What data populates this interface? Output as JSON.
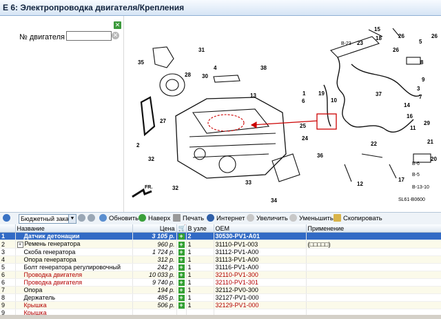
{
  "window": {
    "title": "E 6: Электропроводка двигателя/Крепления"
  },
  "left_panel": {
    "close_icon": "green-close-icon",
    "engine_label": "№ двигателя",
    "engine_value": "",
    "clear_icon": "clear-icon"
  },
  "diagram": {
    "callouts": [
      "35",
      "31",
      "28",
      "30",
      "4",
      "38",
      "13",
      "27",
      "2",
      "32",
      "32",
      "33",
      "34",
      "1",
      "18",
      "10",
      "36",
      "25",
      "24",
      "26",
      "15",
      "23",
      "17",
      "12",
      "19",
      "14",
      "37",
      "6",
      "16",
      "7",
      "22",
      "11",
      "8",
      "9",
      "3",
      "29",
      "21",
      "20",
      "5",
      "26",
      "26"
    ],
    "side_labels": [
      "B-23",
      "B-6",
      "B-5",
      "B-13-10"
    ],
    "front_marker": "FR.",
    "figure_code": "SL61-B0600",
    "title": ""
  },
  "toolbar": {
    "price_select": "Бюджетный зака",
    "refresh": "Обновить",
    "up": "Наверх",
    "print": "Печать",
    "internet": "Интернет",
    "zoom_in": "Увеличить",
    "zoom_out": "Уменьшить",
    "copy": "Скопировать"
  },
  "table": {
    "columns": [
      "Название",
      "Цена",
      "В узле",
      "OEM",
      "Применение"
    ],
    "rows": [
      {
        "num": "1",
        "name": "Датчик детонации",
        "price": "3 105 р.",
        "qty": "2",
        "oem": "30530-PV1-A01",
        "app": "",
        "selected": true,
        "red": false
      },
      {
        "num": "2",
        "name": "Ремень генератора",
        "price": "960 р.",
        "qty": "1",
        "oem": "31110-PV1-003",
        "app": "(□□□□□)",
        "selected": false,
        "red": false,
        "expander": true
      },
      {
        "num": "3",
        "name": "Скоба генератора",
        "price": "1 724 р.",
        "qty": "1",
        "oem": "31112-PV1-A00",
        "app": "",
        "selected": false,
        "red": false
      },
      {
        "num": "4",
        "name": "Опора генератора",
        "price": "312 р.",
        "qty": "1",
        "oem": "31113-PV1-A00",
        "app": "",
        "selected": false,
        "red": false
      },
      {
        "num": "5",
        "name": "Болт генератора регулировочный",
        "price": "242 р.",
        "qty": "1",
        "oem": "31116-PV1-A00",
        "app": "",
        "selected": false,
        "red": false
      },
      {
        "num": "6",
        "name": "Проводка двигателя",
        "price": "10 033 р.",
        "qty": "1",
        "oem": "32110-PV1-300",
        "app": "",
        "selected": false,
        "red": true
      },
      {
        "num": "6",
        "name": "Проводка двигателя",
        "price": "9 740 р.",
        "qty": "1",
        "oem": "32110-PV1-301",
        "app": "",
        "selected": false,
        "red": true
      },
      {
        "num": "7",
        "name": "Опора",
        "price": "194 р.",
        "qty": "1",
        "oem": "32112-PV0-300",
        "app": "",
        "selected": false,
        "red": false
      },
      {
        "num": "8",
        "name": "Держатель",
        "price": "485 р.",
        "qty": "1",
        "oem": "32127-PV1-000",
        "app": "",
        "selected": false,
        "red": false
      },
      {
        "num": "9",
        "name": "Крышка",
        "price": "506 р.",
        "qty": "1",
        "oem": "32129-PV1-000",
        "app": "",
        "selected": false,
        "red": true
      },
      {
        "num": "9",
        "name": "Крышка",
        "price": "",
        "qty": "",
        "oem": "",
        "app": "",
        "selected": false,
        "red": true
      }
    ]
  },
  "colors": {
    "selection": "#316ac5",
    "header_gradient_bottom": "#d6e5f5",
    "red_text": "#b30000",
    "green_plus": "#32a032"
  }
}
